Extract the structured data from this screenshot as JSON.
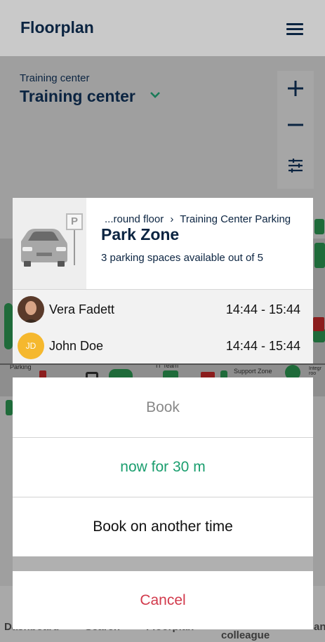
{
  "header": {
    "title": "Floorplan"
  },
  "location": {
    "subtitle": "Training center",
    "current": "Training center"
  },
  "card": {
    "breadcrumb_floor": "...round floor",
    "breadcrumb_sep": "›",
    "breadcrumb_area": "Training Center Parking",
    "zone_title": "Park Zone",
    "availability": "3 parking spaces available out of 5",
    "sign_letter": "P"
  },
  "reservations": [
    {
      "name": "Vera Fadett",
      "time": "14:44 - 15:44",
      "avatar": "photo"
    },
    {
      "name": "John Doe",
      "time": "14:44 - 15:44",
      "avatar": "JD"
    }
  ],
  "sheet": {
    "title": "Book",
    "now_label": "now for 30 m",
    "other_label": "Book on another time",
    "cancel_label": "Cancel"
  },
  "map_labels": {
    "support_zone": "Support Zone",
    "team": "IT Team",
    "parking": "Parking",
    "integr": "Integr\nroo"
  },
  "bottom_nav": [
    "Dashboard",
    "Search",
    "Floorplan",
    "colleague",
    "an"
  ],
  "colors": {
    "navy": "#0b2441",
    "green": "#1a9e6e",
    "red": "#d23a4c",
    "avatar_jd": "#f5b82e"
  },
  "icons": [
    "menu-icon",
    "chevron-down-icon",
    "plus-icon",
    "minus-icon",
    "filter-icon",
    "car-icon",
    "parking-sign-icon"
  ]
}
